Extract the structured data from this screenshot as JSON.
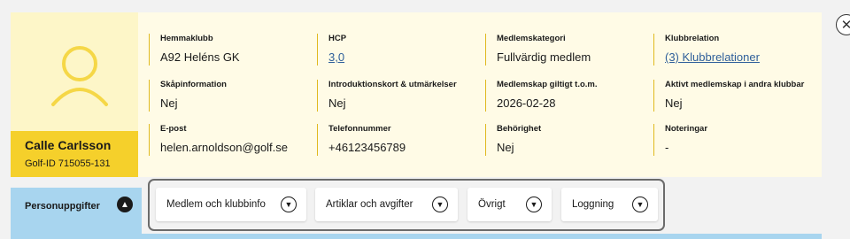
{
  "profile": {
    "name": "Calle Carlsson",
    "golf_id": "Golf-ID 715055-131",
    "avatar_icon": "user-avatar-icon"
  },
  "info": [
    {
      "label": "Hemmaklubb",
      "value": "A92 Heléns GK",
      "link": false
    },
    {
      "label": "HCP",
      "value": "3,0",
      "link": true
    },
    {
      "label": "Medlemskategori",
      "value": "Fullvärdig medlem",
      "link": false
    },
    {
      "label": "Klubbrelation",
      "value": "(3) Klubbrelationer",
      "link": true
    },
    {
      "label": "Skåpinformation",
      "value": "Nej",
      "link": false
    },
    {
      "label": "Introduktionskort & utmärkelser",
      "value": "Nej",
      "link": false
    },
    {
      "label": "Medlemskap giltigt t.o.m.",
      "value": "2026-02-28",
      "link": false
    },
    {
      "label": "Aktivt medlemskap i andra klubbar",
      "value": "Nej",
      "link": false
    },
    {
      "label": "E-post",
      "value": "helen.arnoldson@golf.se",
      "link": false
    },
    {
      "label": "Telefonnummer",
      "value": "+46123456789",
      "link": false
    },
    {
      "label": "Behörighet",
      "value": "Nej",
      "link": false
    },
    {
      "label": "Noteringar",
      "value": "-",
      "link": false
    }
  ],
  "tabs": {
    "active": {
      "label": "Personuppgifter",
      "icon": "chevron-up-icon"
    },
    "pills": [
      {
        "label": "Medlem och klubbinfo",
        "icon": "chevron-down-icon"
      },
      {
        "label": "Artiklar och avgifter",
        "icon": "chevron-down-icon"
      },
      {
        "label": "Övrigt",
        "icon": "chevron-down-icon"
      },
      {
        "label": "Loggning",
        "icon": "chevron-down-icon"
      }
    ]
  },
  "close": {
    "icon": "close-icon",
    "glyph": "✕"
  },
  "colors": {
    "avatar_bg": "#fdf6c8",
    "name_bg": "#f5d02b",
    "panel_bg": "#fffbe6",
    "divider": "#e0b91f",
    "link": "#2f5f9a",
    "tab_active": "#a8d5ef"
  }
}
